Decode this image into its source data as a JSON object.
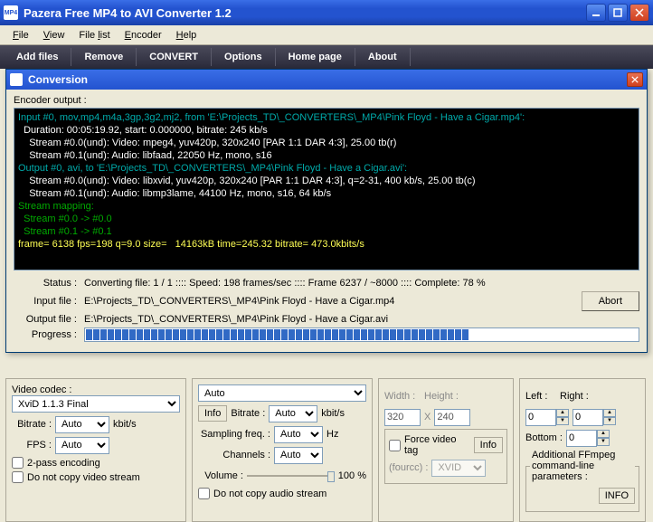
{
  "app": {
    "title": "Pazera Free MP4 to AVI Converter 1.2"
  },
  "menu": {
    "file": "File",
    "view": "View",
    "filelist": "File list",
    "encoder": "Encoder",
    "help": "Help"
  },
  "toolbar": {
    "add": "Add files",
    "remove": "Remove",
    "convert": "CONVERT",
    "options": "Options",
    "home": "Home page",
    "about": "About"
  },
  "modal": {
    "title": "Conversion",
    "encoder_label": "Encoder output :",
    "console": {
      "l1": "Input #0, mov,mp4,m4a,3gp,3g2,mj2, from 'E:\\Projects_TD\\_CONVERTERS\\_MP4\\Pink Floyd - Have a Cigar.mp4':",
      "l2": "  Duration: 00:05:19.92, start: 0.000000, bitrate: 245 kb/s",
      "l3": "    Stream #0.0(und): Video: mpeg4, yuv420p, 320x240 [PAR 1:1 DAR 4:3], 25.00 tb(r)",
      "l4": "    Stream #0.1(und): Audio: libfaad, 22050 Hz, mono, s16",
      "l5": "Output #0, avi, to 'E:\\Projects_TD\\_CONVERTERS\\_MP4\\Pink Floyd - Have a Cigar.avi':",
      "l6": "    Stream #0.0(und): Video: libxvid, yuv420p, 320x240 [PAR 1:1 DAR 4:3], q=2-31, 400 kb/s, 25.00 tb(c)",
      "l7": "    Stream #0.1(und): Audio: libmp3lame, 44100 Hz, mono, s16, 64 kb/s",
      "l8": "Stream mapping:",
      "l9": "  Stream #0.0 -> #0.0",
      "l10": "  Stream #0.1 -> #0.1",
      "l11": "frame= 6138 fps=198 q=9.0 size=   14163kB time=245.32 bitrate= 473.0kbits/s"
    },
    "status_label": "Status :",
    "status_value": "Converting file: 1 / 1  ::::  Speed: 198 frames/sec  ::::  Frame 6237 / ~8000  ::::  Complete: 78 %",
    "input_label": "Input file :",
    "input_value": "E:\\Projects_TD\\_CONVERTERS\\_MP4\\Pink Floyd - Have a Cigar.mp4",
    "output_label": "Output file :",
    "output_value": "E:\\Projects_TD\\_CONVERTERS\\_MP4\\Pink Floyd - Have a Cigar.avi",
    "progress_label": "Progress :",
    "abort": "Abort",
    "progress_pct": 78
  },
  "video": {
    "header": "Video codec :",
    "codec": "XviD 1.1.3 Final",
    "bitrate_label": "Bitrate :",
    "bitrate": "Auto",
    "bitrate_unit": "kbit/s",
    "fps_label": "FPS :",
    "fps": "Auto",
    "twopass": "2-pass encoding",
    "nocopy": "Do not copy video stream"
  },
  "audio": {
    "top": "Auto",
    "info": "Info",
    "bitrate_label": "Bitrate :",
    "bitrate": "Auto",
    "bitrate_unit": "kbit/s",
    "sampling_label": "Sampling freq. :",
    "sampling": "Auto",
    "sampling_unit": "Hz",
    "channels_label": "Channels :",
    "channels": "Auto",
    "volume_label": "Volume :",
    "volume_pct": "100 %",
    "nocopy": "Do not copy audio stream"
  },
  "size": {
    "width_label": "Width :",
    "height_label": "Height :",
    "width": "320",
    "height": "240",
    "x": "X",
    "force_tag": "Force video tag",
    "info": "Info",
    "fourcc_label": "(fourcc) :",
    "fourcc": "XVID"
  },
  "crop": {
    "left_label": "Left :",
    "right_label": "Right :",
    "left": "0",
    "right": "0",
    "bottom_label": "Bottom :",
    "bottom": "0"
  },
  "extra": {
    "label": "Additional FFmpeg command-line parameters :",
    "info": "INFO"
  }
}
